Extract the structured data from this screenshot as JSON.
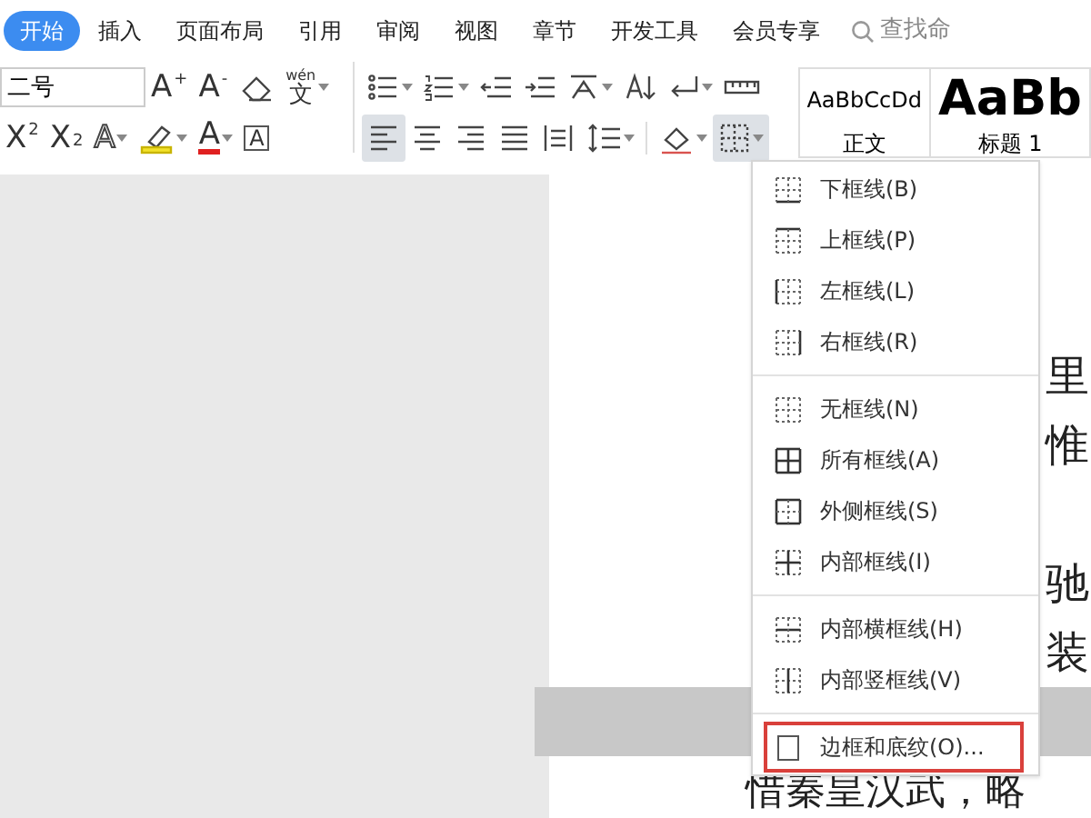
{
  "tabs": [
    {
      "label": "开始",
      "selected": true
    },
    {
      "label": "插入",
      "selected": false
    },
    {
      "label": "页面布局",
      "selected": false
    },
    {
      "label": "引用",
      "selected": false
    },
    {
      "label": "审阅",
      "selected": false
    },
    {
      "label": "视图",
      "selected": false
    },
    {
      "label": "章节",
      "selected": false
    },
    {
      "label": "开发工具",
      "selected": false
    },
    {
      "label": "会员专享",
      "selected": false
    }
  ],
  "search": {
    "placeholder": "查找命"
  },
  "font_size": {
    "value": "二号"
  },
  "toolbar_row_1": [
    {
      "kind": "text",
      "label": "A$^{+}$",
      "dropdown": false
    },
    {
      "kind": "text",
      "label": "A$^{-}$",
      "dropdown": false
    },
    {
      "kind": "eraser",
      "dropdown": false
    },
    {
      "kind": "pinyin",
      "label": "wén",
      "sublabel": "文",
      "dropdown": true
    },
    {
      "kind": "sep"
    },
    {
      "kind": "bullets",
      "dropdown": true
    },
    {
      "kind": "numbering",
      "dropdown": true
    },
    {
      "kind": "outdent",
      "dropdown": false
    },
    {
      "kind": "indent",
      "dropdown": false
    },
    {
      "kind": "asian-layout",
      "dropdown": true
    },
    {
      "kind": "sort",
      "dropdown": false
    },
    {
      "kind": "para-mark",
      "dropdown": true
    },
    {
      "kind": "ruler",
      "dropdown": false
    }
  ],
  "toolbar_row_2": [
    {
      "kind": "text",
      "label": "X$^{2}$",
      "dropdown": false,
      "selected": false
    },
    {
      "kind": "text",
      "label": "X$_{2}$",
      "dropdown": false,
      "selected": false
    },
    {
      "kind": "text-effect",
      "label": "A",
      "dropdown": true,
      "selected": false
    },
    {
      "kind": "highlighter",
      "dropdown": true,
      "selected": false
    },
    {
      "kind": "font-color",
      "label": "A",
      "dropdown": true,
      "selected": false
    },
    {
      "kind": "char-border",
      "label": "A",
      "dropdown": false,
      "selected": false
    },
    {
      "kind": "sep"
    },
    {
      "kind": "align-left",
      "dropdown": false,
      "selected": true
    },
    {
      "kind": "align-center",
      "dropdown": false,
      "selected": false
    },
    {
      "kind": "align-right",
      "dropdown": false,
      "selected": false
    },
    {
      "kind": "justify",
      "dropdown": false,
      "selected": false
    },
    {
      "kind": "distribute",
      "dropdown": false,
      "selected": false
    },
    {
      "kind": "line-spacing",
      "dropdown": true,
      "selected": false
    },
    {
      "kind": "sep"
    },
    {
      "kind": "shading",
      "dropdown": true,
      "selected": false
    },
    {
      "kind": "borders",
      "dropdown": true,
      "selected": true
    }
  ],
  "styles": [
    {
      "preview": "AaBbCcDd",
      "name": "正文",
      "kind": "normal"
    },
    {
      "preview": "AaBb",
      "name": "标题 1",
      "kind": "heading"
    }
  ],
  "border_menu": [
    [
      {
        "label": "下框线(B)",
        "kind": "bottom",
        "highlighted": false
      },
      {
        "label": "上框线(P)",
        "kind": "top",
        "highlighted": false
      },
      {
        "label": "左框线(L)",
        "kind": "left",
        "highlighted": false
      },
      {
        "label": "右框线(R)",
        "kind": "right",
        "highlighted": false
      }
    ],
    [
      {
        "label": "无框线(N)",
        "kind": "none",
        "highlighted": false
      },
      {
        "label": "所有框线(A)",
        "kind": "all",
        "highlighted": false
      },
      {
        "label": "外侧框线(S)",
        "kind": "outside",
        "highlighted": false
      },
      {
        "label": "内部框线(I)",
        "kind": "inside",
        "highlighted": false
      }
    ],
    [
      {
        "label": "内部横框线(H)",
        "kind": "inside-h",
        "highlighted": false
      },
      {
        "label": "内部竖框线(V)",
        "kind": "inside-v",
        "highlighted": false
      }
    ],
    [
      {
        "label": "边框和底纹(O)...",
        "kind": "dialog",
        "highlighted": true
      }
    ]
  ],
  "document_lines": [
    {
      "kind": "blank"
    },
    {
      "kind": "blank"
    },
    {
      "kind": "right",
      "text": "里"
    },
    {
      "kind": "right",
      "text": "惟"
    },
    {
      "kind": "blank"
    },
    {
      "kind": "right",
      "text": "驰"
    },
    {
      "kind": "right",
      "text": "装"
    },
    {
      "kind": "blank",
      "shaded": true
    },
    {
      "kind": "full",
      "text": "惜秦皇汉武，略"
    }
  ]
}
